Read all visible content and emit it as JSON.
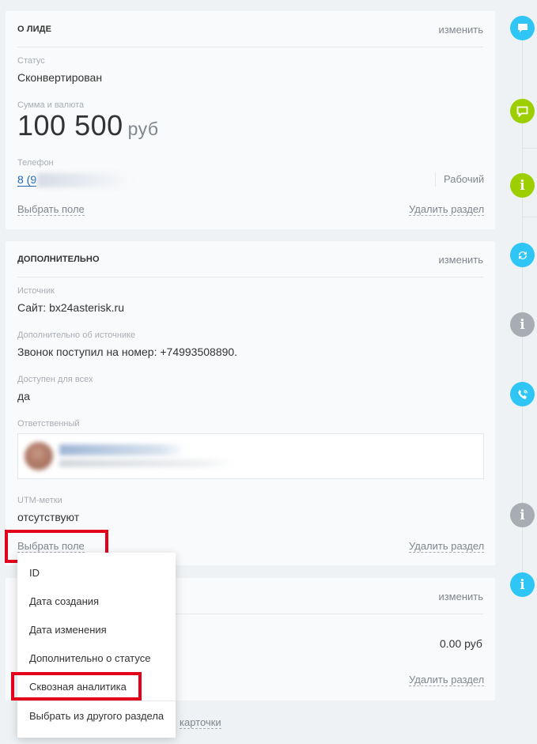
{
  "lead_section": {
    "title": "О ЛИДЕ",
    "edit_label": "изменить",
    "status_label": "Статус",
    "status_value": "Сконвертирован",
    "amount_label": "Сумма и валюта",
    "amount_value": "100 500",
    "amount_currency": "руб",
    "phone_label": "Телефон",
    "phone_value": "8 (9",
    "phone_type": "Рабочий",
    "select_field_label": "Выбрать поле",
    "delete_section_label": "Удалить раздел"
  },
  "additional_section": {
    "title": "ДОПОЛНИТЕЛЬНО",
    "edit_label": "изменить",
    "source_label": "Источник",
    "source_value": "Сайт: bx24asterisk.ru",
    "source_info_label": "Дополнительно об источнике",
    "source_info_value": "Звонок поступил на номер: +74993508890.",
    "available_label": "Доступен для всех",
    "available_value": "да",
    "responsible_label": "Ответственный",
    "utm_label": "UTM-метки",
    "utm_value": "отсутствуют",
    "select_field_label": "Выбрать поле",
    "delete_section_label": "Удалить раздел"
  },
  "third_section": {
    "edit_label": "изменить",
    "amount_value": "0.00 руб",
    "delete_section_label": "Удалить раздел"
  },
  "footer": {
    "link_label": "карточки"
  },
  "dropdown": {
    "items": [
      "ID",
      "Дата создания",
      "Дата изменения",
      "Дополнительно о статусе",
      "Сквозная аналитика"
    ],
    "other_section_label": "Выбрать из другого раздела"
  },
  "timeline": {
    "icons": [
      {
        "name": "comment-icon",
        "color": "#2fc6f6"
      },
      {
        "name": "chat-icon",
        "color": "#9dcf00"
      },
      {
        "name": "info-icon",
        "color": "#9dcf00"
      },
      {
        "name": "refresh-icon",
        "color": "#2fc6f6"
      },
      {
        "name": "info-icon",
        "color": "#a8adb4"
      },
      {
        "name": "phone-icon",
        "color": "#2fc6f6"
      },
      {
        "name": "info-icon",
        "color": "#a8adb4"
      },
      {
        "name": "info-icon",
        "color": "#2fc6f6"
      }
    ]
  },
  "colors": {
    "highlight": "#e3001b",
    "link": "#2067b0"
  }
}
